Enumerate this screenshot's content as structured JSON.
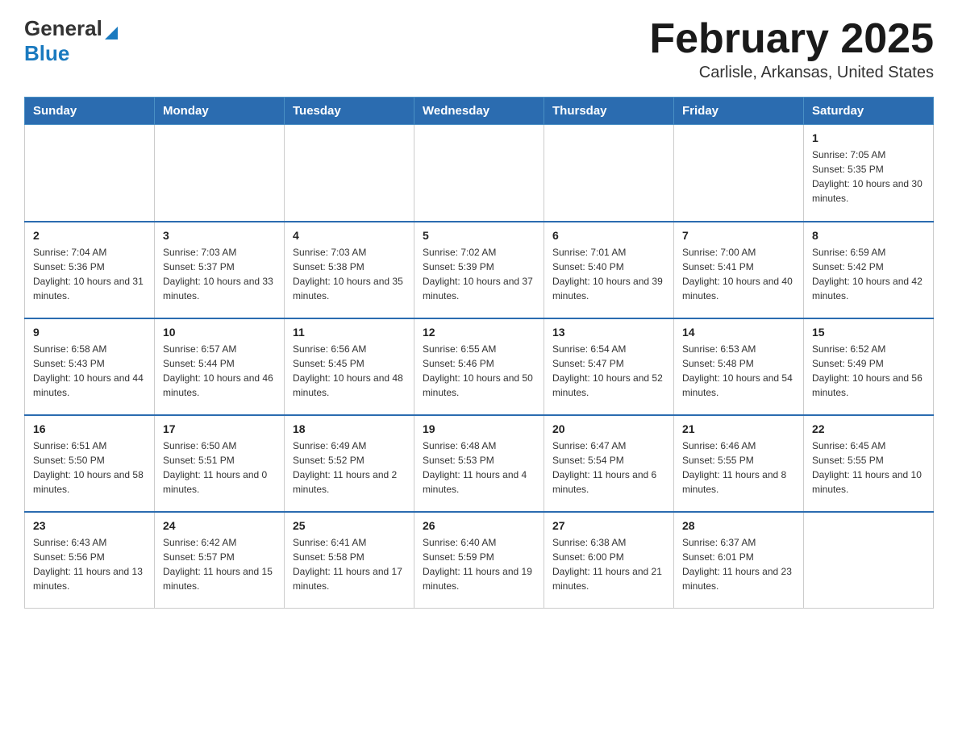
{
  "header": {
    "logo_general": "General",
    "logo_blue": "Blue",
    "month_title": "February 2025",
    "location": "Carlisle, Arkansas, United States"
  },
  "days_of_week": [
    "Sunday",
    "Monday",
    "Tuesday",
    "Wednesday",
    "Thursday",
    "Friday",
    "Saturday"
  ],
  "weeks": [
    [
      {
        "day": "",
        "sunrise": "",
        "sunset": "",
        "daylight": ""
      },
      {
        "day": "",
        "sunrise": "",
        "sunset": "",
        "daylight": ""
      },
      {
        "day": "",
        "sunrise": "",
        "sunset": "",
        "daylight": ""
      },
      {
        "day": "",
        "sunrise": "",
        "sunset": "",
        "daylight": ""
      },
      {
        "day": "",
        "sunrise": "",
        "sunset": "",
        "daylight": ""
      },
      {
        "day": "",
        "sunrise": "",
        "sunset": "",
        "daylight": ""
      },
      {
        "day": "1",
        "sunrise": "Sunrise: 7:05 AM",
        "sunset": "Sunset: 5:35 PM",
        "daylight": "Daylight: 10 hours and 30 minutes."
      }
    ],
    [
      {
        "day": "2",
        "sunrise": "Sunrise: 7:04 AM",
        "sunset": "Sunset: 5:36 PM",
        "daylight": "Daylight: 10 hours and 31 minutes."
      },
      {
        "day": "3",
        "sunrise": "Sunrise: 7:03 AM",
        "sunset": "Sunset: 5:37 PM",
        "daylight": "Daylight: 10 hours and 33 minutes."
      },
      {
        "day": "4",
        "sunrise": "Sunrise: 7:03 AM",
        "sunset": "Sunset: 5:38 PM",
        "daylight": "Daylight: 10 hours and 35 minutes."
      },
      {
        "day": "5",
        "sunrise": "Sunrise: 7:02 AM",
        "sunset": "Sunset: 5:39 PM",
        "daylight": "Daylight: 10 hours and 37 minutes."
      },
      {
        "day": "6",
        "sunrise": "Sunrise: 7:01 AM",
        "sunset": "Sunset: 5:40 PM",
        "daylight": "Daylight: 10 hours and 39 minutes."
      },
      {
        "day": "7",
        "sunrise": "Sunrise: 7:00 AM",
        "sunset": "Sunset: 5:41 PM",
        "daylight": "Daylight: 10 hours and 40 minutes."
      },
      {
        "day": "8",
        "sunrise": "Sunrise: 6:59 AM",
        "sunset": "Sunset: 5:42 PM",
        "daylight": "Daylight: 10 hours and 42 minutes."
      }
    ],
    [
      {
        "day": "9",
        "sunrise": "Sunrise: 6:58 AM",
        "sunset": "Sunset: 5:43 PM",
        "daylight": "Daylight: 10 hours and 44 minutes."
      },
      {
        "day": "10",
        "sunrise": "Sunrise: 6:57 AM",
        "sunset": "Sunset: 5:44 PM",
        "daylight": "Daylight: 10 hours and 46 minutes."
      },
      {
        "day": "11",
        "sunrise": "Sunrise: 6:56 AM",
        "sunset": "Sunset: 5:45 PM",
        "daylight": "Daylight: 10 hours and 48 minutes."
      },
      {
        "day": "12",
        "sunrise": "Sunrise: 6:55 AM",
        "sunset": "Sunset: 5:46 PM",
        "daylight": "Daylight: 10 hours and 50 minutes."
      },
      {
        "day": "13",
        "sunrise": "Sunrise: 6:54 AM",
        "sunset": "Sunset: 5:47 PM",
        "daylight": "Daylight: 10 hours and 52 minutes."
      },
      {
        "day": "14",
        "sunrise": "Sunrise: 6:53 AM",
        "sunset": "Sunset: 5:48 PM",
        "daylight": "Daylight: 10 hours and 54 minutes."
      },
      {
        "day": "15",
        "sunrise": "Sunrise: 6:52 AM",
        "sunset": "Sunset: 5:49 PM",
        "daylight": "Daylight: 10 hours and 56 minutes."
      }
    ],
    [
      {
        "day": "16",
        "sunrise": "Sunrise: 6:51 AM",
        "sunset": "Sunset: 5:50 PM",
        "daylight": "Daylight: 10 hours and 58 minutes."
      },
      {
        "day": "17",
        "sunrise": "Sunrise: 6:50 AM",
        "sunset": "Sunset: 5:51 PM",
        "daylight": "Daylight: 11 hours and 0 minutes."
      },
      {
        "day": "18",
        "sunrise": "Sunrise: 6:49 AM",
        "sunset": "Sunset: 5:52 PM",
        "daylight": "Daylight: 11 hours and 2 minutes."
      },
      {
        "day": "19",
        "sunrise": "Sunrise: 6:48 AM",
        "sunset": "Sunset: 5:53 PM",
        "daylight": "Daylight: 11 hours and 4 minutes."
      },
      {
        "day": "20",
        "sunrise": "Sunrise: 6:47 AM",
        "sunset": "Sunset: 5:54 PM",
        "daylight": "Daylight: 11 hours and 6 minutes."
      },
      {
        "day": "21",
        "sunrise": "Sunrise: 6:46 AM",
        "sunset": "Sunset: 5:55 PM",
        "daylight": "Daylight: 11 hours and 8 minutes."
      },
      {
        "day": "22",
        "sunrise": "Sunrise: 6:45 AM",
        "sunset": "Sunset: 5:55 PM",
        "daylight": "Daylight: 11 hours and 10 minutes."
      }
    ],
    [
      {
        "day": "23",
        "sunrise": "Sunrise: 6:43 AM",
        "sunset": "Sunset: 5:56 PM",
        "daylight": "Daylight: 11 hours and 13 minutes."
      },
      {
        "day": "24",
        "sunrise": "Sunrise: 6:42 AM",
        "sunset": "Sunset: 5:57 PM",
        "daylight": "Daylight: 11 hours and 15 minutes."
      },
      {
        "day": "25",
        "sunrise": "Sunrise: 6:41 AM",
        "sunset": "Sunset: 5:58 PM",
        "daylight": "Daylight: 11 hours and 17 minutes."
      },
      {
        "day": "26",
        "sunrise": "Sunrise: 6:40 AM",
        "sunset": "Sunset: 5:59 PM",
        "daylight": "Daylight: 11 hours and 19 minutes."
      },
      {
        "day": "27",
        "sunrise": "Sunrise: 6:38 AM",
        "sunset": "Sunset: 6:00 PM",
        "daylight": "Daylight: 11 hours and 21 minutes."
      },
      {
        "day": "28",
        "sunrise": "Sunrise: 6:37 AM",
        "sunset": "Sunset: 6:01 PM",
        "daylight": "Daylight: 11 hours and 23 minutes."
      },
      {
        "day": "",
        "sunrise": "",
        "sunset": "",
        "daylight": ""
      }
    ]
  ]
}
